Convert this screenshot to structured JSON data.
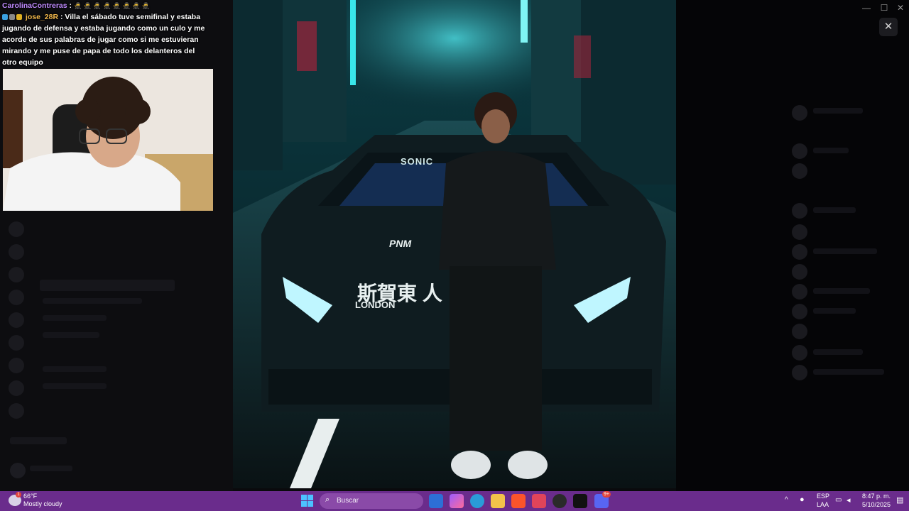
{
  "chat": {
    "line1_user": "CarolinaContreras",
    "line1_sep": ":",
    "line1_emotes": "🥷 🥷 🥷 🥷 🥷 🥷 🥷 🥷",
    "line2_user": "jose_28R",
    "line2_sep": ":",
    "line2_text": "Villa el sábado tuve semifinal y estaba jugando de defensa y estaba jugando como un culo y me acorde de sus palabras de jugar como si me estuvieran mirando y me puse de papa de todo los delanteros del otro equipo"
  },
  "viewer": {
    "close_glyph": "✕",
    "car_brand": "SONIC",
    "car_text_1": "PNM",
    "car_kanji": "斯賀東 人",
    "car_city": "LONDON"
  },
  "window": {
    "minimize": "—",
    "maximize": "☐",
    "close": "✕"
  },
  "taskbar": {
    "weather_temp": "66°F",
    "weather_desc": "Mostly cloudy",
    "search_placeholder": "Buscar",
    "lang1": "ESP",
    "lang2": "LAA",
    "time": "8:47 p. m.",
    "date": "5/10/2025",
    "notif_count": "9+",
    "weather_badge": "1"
  },
  "colors": {
    "taskbar": "#6a2c8c",
    "chat_user1": "#c08bff",
    "chat_user2": "#f3b94d"
  }
}
